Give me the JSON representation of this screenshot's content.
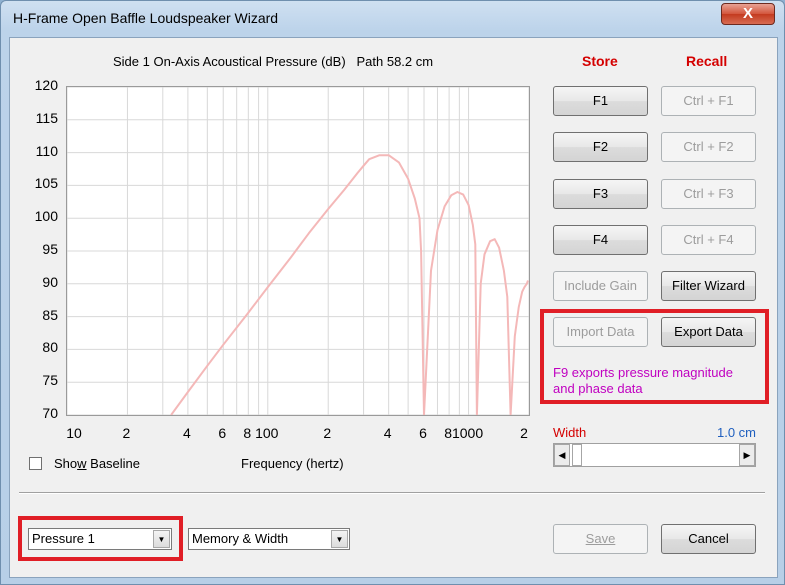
{
  "window": {
    "title": "H-Frame Open Baffle Loudspeaker Wizard",
    "close_label": "X"
  },
  "graph": {
    "title": "Side 1 On-Axis Acoustical Pressure (dB)   Path 58.2 cm",
    "x_axis_label": "Frequency (hertz)"
  },
  "chart_data": {
    "type": "line",
    "title": "Side 1 On-Axis Acoustical Pressure (dB)   Path 58.2 cm",
    "xlabel": "Frequency (hertz)",
    "ylabel": "",
    "x_scale": "log",
    "xlim": [
      10,
      2000
    ],
    "ylim": [
      70,
      120
    ],
    "y_ticks": [
      "120",
      "115",
      "110",
      "105",
      "100",
      "95",
      "90",
      "85",
      "80",
      "75",
      "70"
    ],
    "x_ticks": [
      "10",
      "2",
      "4",
      "6",
      "8",
      "100",
      "2",
      "4",
      "6",
      "8",
      "1000",
      "2"
    ],
    "grid": true,
    "series": [
      {
        "color": "#f4b8b8",
        "x": [
          33,
          40,
          50,
          60,
          80,
          100,
          130,
          160,
          200,
          240,
          280,
          300,
          320,
          360,
          400,
          450,
          500,
          540,
          570,
          580,
          600,
          650,
          700,
          760,
          820,
          880,
          940,
          1000,
          1050,
          1080,
          1100,
          1150,
          1200,
          1280,
          1350,
          1420,
          1500,
          1560,
          1620,
          1700,
          1780,
          1850,
          1900,
          1950,
          2000
        ],
        "y": [
          70,
          73.5,
          77.5,
          80.7,
          85.6,
          89.5,
          94,
          97.7,
          101.4,
          104.3,
          106.9,
          108,
          109,
          109.6,
          109.6,
          108.5,
          106,
          103,
          100,
          95,
          70,
          92,
          98.2,
          101.8,
          103.5,
          104,
          103.6,
          102,
          99,
          96,
          70,
          90,
          94.5,
          96.5,
          96.8,
          95.5,
          92,
          88,
          70,
          82,
          86.5,
          88.8,
          89.5,
          90,
          90.5
        ]
      }
    ]
  },
  "buttons": {
    "store_label": "Store",
    "recall_label": "Recall",
    "f1": "F1",
    "f2": "F2",
    "f3": "F3",
    "f4": "F4",
    "ctrl_f1": "Ctrl + F1",
    "ctrl_f2": "Ctrl + F2",
    "ctrl_f3": "Ctrl + F3",
    "ctrl_f4": "Ctrl + F4",
    "include_gain": "Include Gain",
    "filter_wizard": "Filter Wizard",
    "import_data": "Import Data",
    "export_data": "Export Data",
    "save": "Save",
    "cancel": "Cancel"
  },
  "export_note": {
    "line1": "F9 exports pressure magnitude",
    "line2": "and phase data"
  },
  "width_control": {
    "label": "Width",
    "value": "1.0 cm"
  },
  "baseline": {
    "pre": "Sho",
    "accel": "w",
    "post": " Baseline"
  },
  "selectors": {
    "pressure": "Pressure 1",
    "memory": "Memory & Width"
  },
  "colors": {
    "accent_red": "#d40000",
    "magenta_note": "#c000c0",
    "highlight": "#e01e26",
    "curve": "#f4b8b8"
  }
}
